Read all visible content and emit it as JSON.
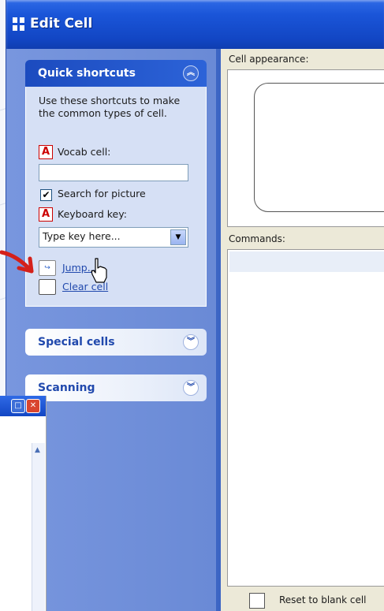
{
  "window": {
    "title": "Edit Cell"
  },
  "sidebar": {
    "quick_shortcuts": {
      "title": "Quick shortcuts",
      "intro": "Use these shortcuts to make the common types of cell.",
      "vocab_label": "Vocab cell:",
      "vocab_value": "",
      "search_picture_label": "Search for picture",
      "search_picture_checked": true,
      "keyboard_label": "Keyboard key:",
      "keyboard_value": "Type key here...",
      "jump_label": "Jump...",
      "clear_label": "Clear cell"
    },
    "special_cells": {
      "title": "Special cells"
    },
    "scanning": {
      "title": "Scanning"
    }
  },
  "main": {
    "appearance_label": "Cell appearance:",
    "commands_label": "Commands:",
    "reset_label": "Reset to blank cell"
  },
  "colors": {
    "title_bar": "#1a55d8",
    "pane_bg": "#6a8ad6",
    "group_header": "#1c4bbf",
    "link": "#2149ad",
    "annotation_arrow": "#d4201a"
  }
}
